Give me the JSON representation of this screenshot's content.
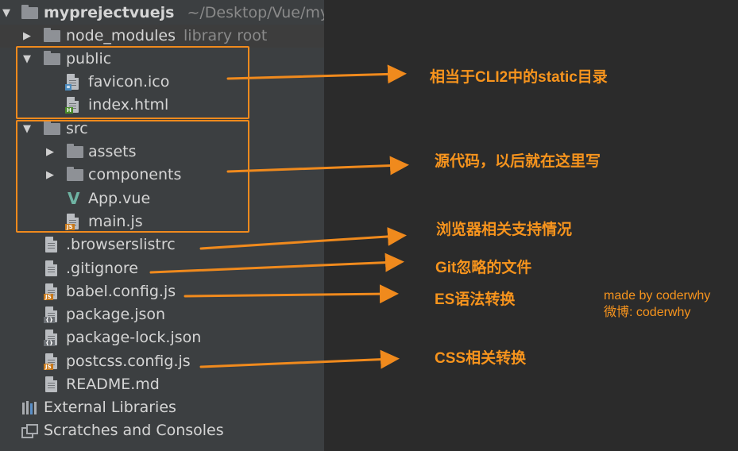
{
  "project": {
    "name": "myprejectvuejs",
    "path": "~/Desktop/Vue/myp"
  },
  "tree": {
    "node_modules": {
      "label": "node_modules",
      "hint": "library root"
    },
    "public": {
      "label": "public",
      "children": [
        "favicon.ico",
        "index.html"
      ]
    },
    "src": {
      "label": "src",
      "assets": "assets",
      "components": "components",
      "app": "App.vue",
      "main": "main.js"
    },
    "files": [
      ".browserslistrc",
      ".gitignore",
      "babel.config.js",
      "package.json",
      "package-lock.json",
      "postcss.config.js",
      "README.md"
    ],
    "external_libraries": "External Libraries",
    "scratches": "Scratches and Consoles"
  },
  "annotations": {
    "public": "相当于CLI2中的static目录",
    "src": "源代码，以后就在这里写",
    "browserslistrc": "浏览器相关支持情况",
    "gitignore": "Git忽略的文件",
    "babel": "ES语法转换",
    "postcss": "CSS相关转换"
  },
  "credit": {
    "line1": "made by coderwhy",
    "line2": "微博: coderwhy"
  },
  "colors": {
    "panel": "#3c3f41",
    "editor": "#2b2b2b",
    "accent": "#f08a1d",
    "text": "#d5d5d5"
  },
  "icons": {
    "folder": "folder-icon",
    "file": "file-icon",
    "vue": "vue-icon",
    "library": "library-icon",
    "scratch": "scratch-icon"
  }
}
